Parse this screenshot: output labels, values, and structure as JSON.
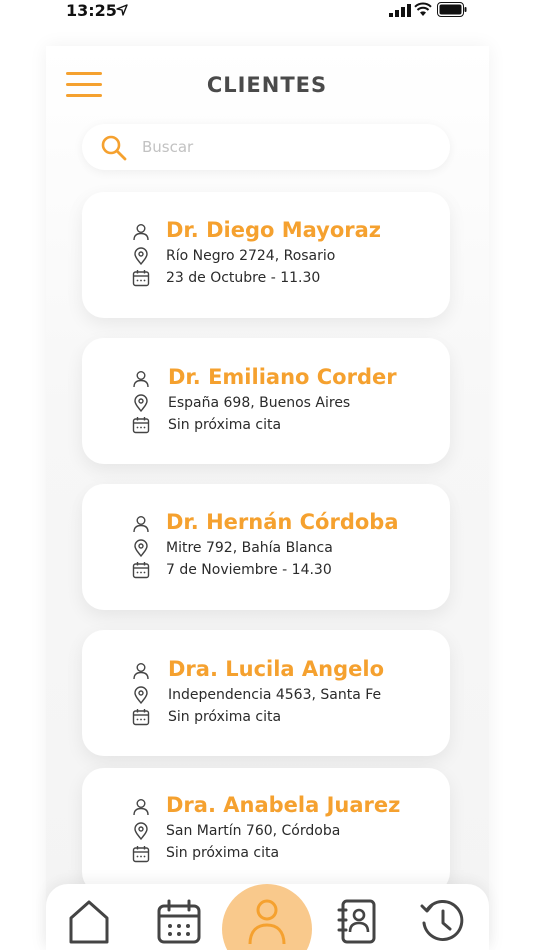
{
  "status_bar": {
    "time": "13:25"
  },
  "header": {
    "title": "CLIENTES"
  },
  "search": {
    "placeholder": "Buscar"
  },
  "clients": [
    {
      "name": "Dr. Diego Mayoraz",
      "address": "Río Negro 2724, Rosario",
      "appointment": "23 de Octubre - 11.30"
    },
    {
      "name": "Dr. Emiliano Corder",
      "address": "España 698, Buenos Aires",
      "appointment": "Sin próxima cita"
    },
    {
      "name": "Dr. Hernán Córdoba",
      "address": "Mitre 792, Bahía Blanca",
      "appointment": "7 de Noviembre - 14.30"
    },
    {
      "name": "Dra. Lucila Angelo",
      "address": "Independencia 4563, Santa Fe",
      "appointment": "Sin próxima cita"
    },
    {
      "name": "Dra. Anabela Juarez",
      "address": "San Martín 760, Córdoba",
      "appointment": "Sin próxima cita"
    }
  ],
  "bottom_nav": {
    "items": [
      {
        "icon": "home-icon"
      },
      {
        "icon": "calendar-icon"
      },
      {
        "icon": "user-icon",
        "active": true
      },
      {
        "icon": "contacts-icon"
      },
      {
        "icon": "history-icon"
      }
    ]
  },
  "colors": {
    "accent": "#f5a12f",
    "active_bg": "#f9c98c",
    "title": "#4a4a4a",
    "text": "#2b2b2b",
    "placeholder": "#c2c2c2",
    "icon": "#444444"
  }
}
